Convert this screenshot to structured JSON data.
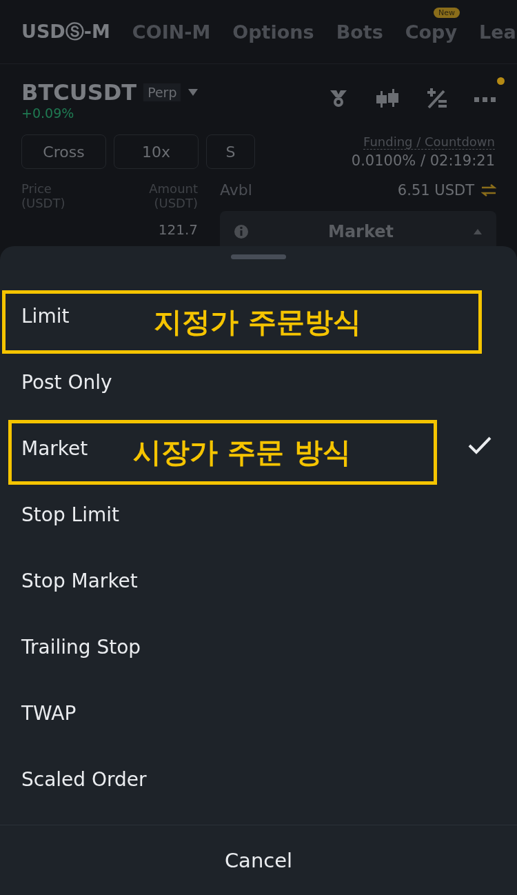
{
  "tabs": [
    {
      "label": "USDⓈ-M",
      "selected": true
    },
    {
      "label": "COIN-M",
      "selected": false
    },
    {
      "label": "Options",
      "selected": false
    },
    {
      "label": "Bots",
      "selected": false
    },
    {
      "label": "Copy",
      "selected": false,
      "badge": "New"
    },
    {
      "label": "Lea",
      "selected": false
    }
  ],
  "symbol": {
    "name": "BTCUSDT",
    "type": "Perp",
    "change": "+0.09%"
  },
  "menu_notification": true,
  "buttons": [
    "Cross",
    "10x",
    "S"
  ],
  "funding": {
    "label": "Funding / Countdown",
    "value": "0.0100% / 02:19:21"
  },
  "order_book": {
    "price_header": "Price\n(USDT)",
    "amount_header": "Amount\n(USDT)",
    "first_amount": "121.7"
  },
  "available": {
    "label": "Avbl",
    "value": "6.51 USDT"
  },
  "order_type_field": {
    "value": "Market"
  },
  "sheet": {
    "options": [
      {
        "label": "Limit",
        "selected": false,
        "annotation": "지정가 주문방식"
      },
      {
        "label": "Post Only",
        "selected": false
      },
      {
        "label": "Market",
        "selected": true,
        "annotation": "시장가 주문 방식"
      },
      {
        "label": "Stop Limit",
        "selected": false
      },
      {
        "label": "Stop Market",
        "selected": false
      },
      {
        "label": "Trailing Stop",
        "selected": false
      },
      {
        "label": "TWAP",
        "selected": false
      },
      {
        "label": "Scaled Order",
        "selected": false
      }
    ],
    "cancel": "Cancel"
  }
}
